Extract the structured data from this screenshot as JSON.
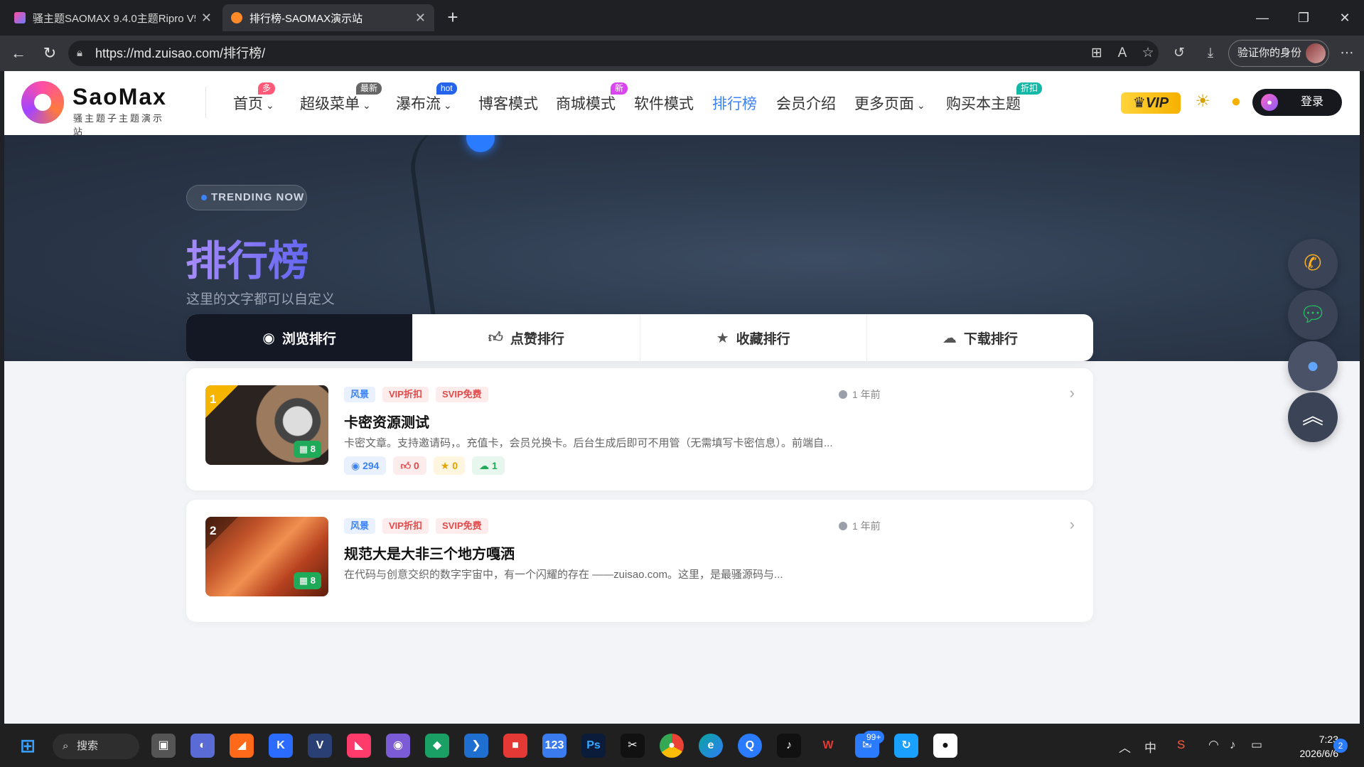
{
  "browser": {
    "tabs": [
      {
        "title": "骚主题SAOMAX 9.4.0主题Ripro V5",
        "active": false
      },
      {
        "title": "排行榜-SAOMAX演示站",
        "active": true
      }
    ],
    "url": "https://md.zuisao.com/排行榜/",
    "verify_label": "验证你的身份"
  },
  "site": {
    "logo_name": "SaoMax",
    "logo_sub": "骚主题子主题演示站",
    "menu": [
      {
        "label": "首页",
        "badge": "多",
        "has_dropdown": true
      },
      {
        "label": "超级菜单",
        "badge": "最新",
        "has_dropdown": true
      },
      {
        "label": "瀑布流",
        "badge": "hot",
        "has_dropdown": true
      },
      {
        "label": "博客模式",
        "badge": "",
        "has_dropdown": false
      },
      {
        "label": "商城模式",
        "badge": "新",
        "has_dropdown": false
      },
      {
        "label": "软件模式",
        "badge": "",
        "has_dropdown": false
      },
      {
        "label": "排行榜",
        "badge": "",
        "has_dropdown": false,
        "active": true
      },
      {
        "label": "会员介绍",
        "badge": "",
        "has_dropdown": false
      },
      {
        "label": "更多页面",
        "badge": "",
        "has_dropdown": true
      },
      {
        "label": "购买本主题",
        "badge": "折扣",
        "has_dropdown": false
      }
    ],
    "vip_label": "VIP",
    "login_label": "登录"
  },
  "hero": {
    "pill": "TRENDING NOW",
    "title": "排行榜",
    "subtitle": "这里的文字都可以自定义"
  },
  "rank_tabs": [
    {
      "label": "浏览排行",
      "icon": "eye-icon",
      "active": true
    },
    {
      "label": "点赞排行",
      "icon": "thumbs-up-icon",
      "active": false
    },
    {
      "label": "收藏排行",
      "icon": "star-icon",
      "active": false
    },
    {
      "label": "下载排行",
      "icon": "cloud-icon",
      "active": false
    }
  ],
  "posts": [
    {
      "rank": "1",
      "image_count": "8",
      "tags": [
        "风景",
        "VIP折扣",
        "SVIP免费"
      ],
      "time": "1 年前",
      "title": "卡密资源测试",
      "excerpt": "卡密文章。支持邀请码，。充值卡，会员兑换卡。后台生成后即可不用管（无需填写卡密信息）。前端自...",
      "views": "294",
      "likes": "0",
      "favorites": "0",
      "downloads": "1"
    },
    {
      "rank": "2",
      "image_count": "8",
      "tags": [
        "风景",
        "VIP折扣",
        "SVIP免费"
      ],
      "time": "1 年前",
      "title": "规范大是大非三个地方嘎洒",
      "excerpt": "在代码与创意交织的数字宇宙中，有一个闪耀的存在 ——zuisao.com。这里，是最骚源码与..."
    }
  ],
  "taskbar": {
    "search_label": "搜索",
    "ime": "中",
    "mail_badge": "99+",
    "time": "7:23",
    "date": "2026/6/6",
    "notif": "2"
  },
  "colors": {
    "accent": "#3b82f6",
    "dark": "#141824",
    "vip": "#f6b100"
  }
}
